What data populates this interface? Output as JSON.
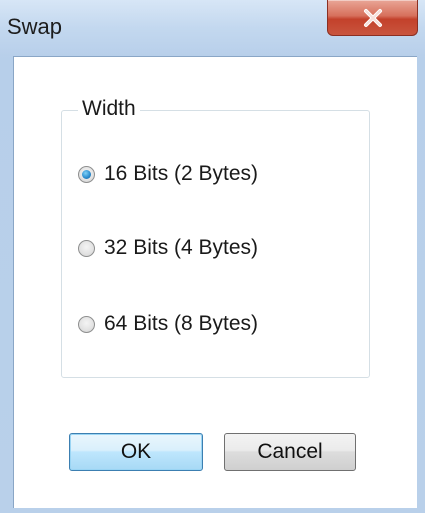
{
  "window": {
    "title": "Swap"
  },
  "group": {
    "legend": "Width",
    "options": [
      {
        "label": "16 Bits (2 Bytes)",
        "checked": true
      },
      {
        "label": "32 Bits (4 Bytes)",
        "checked": false
      },
      {
        "label": "64 Bits (8 Bytes)",
        "checked": false
      }
    ]
  },
  "buttons": {
    "ok": "OK",
    "cancel": "Cancel"
  },
  "icons": {
    "close": "close-icon",
    "radio": "radio-button"
  },
  "colors": {
    "accent": "#3c7fb1",
    "close": "#c3412b"
  }
}
